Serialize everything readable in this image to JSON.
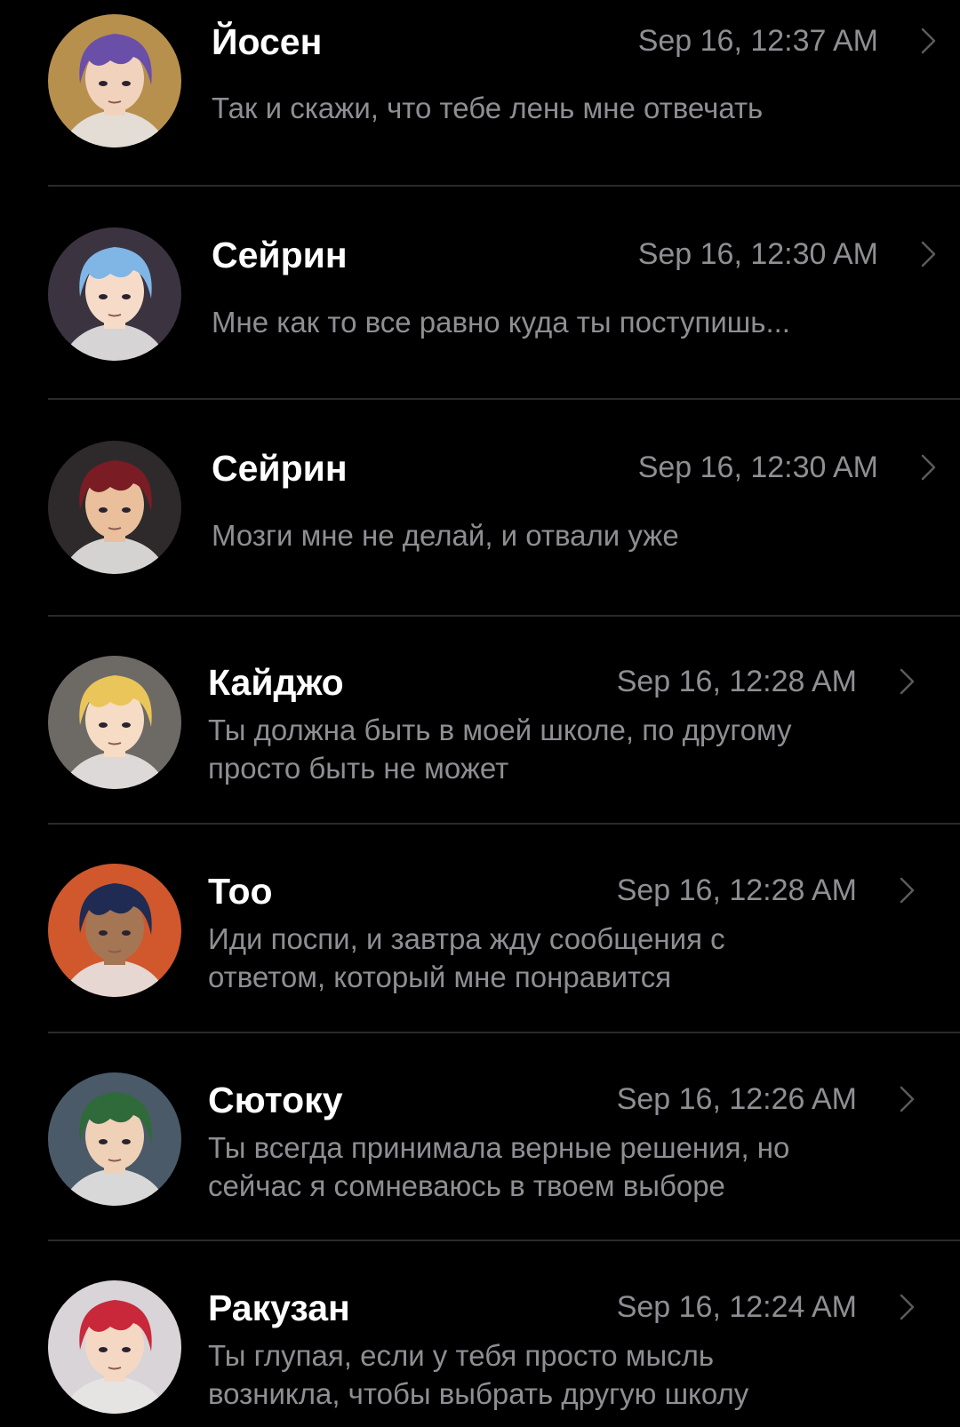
{
  "conversations": [
    {
      "name": "Йосен",
      "time": "Sep 16, 12:37 AM",
      "message_lines": [
        "Так и скажи, что тебе лень мне отвечать"
      ],
      "avatar": {
        "hair": "#6a4fa8",
        "skin": "#f1d3bd",
        "bg": "#b8904e",
        "icon": "avatar-purple-hair"
      }
    },
    {
      "name": "Сейрин",
      "time": "Sep 16, 12:30 AM",
      "message_lines": [
        "Мне как то все равно куда ты поступишь..."
      ],
      "avatar": {
        "hair": "#7fb6e6",
        "skin": "#f6dcc8",
        "bg": "#3b3440",
        "icon": "avatar-blue-hair"
      }
    },
    {
      "name": "Сейрин",
      "time": "Sep 16, 12:30 AM",
      "message_lines": [
        "Мозги мне не делай, и отвали уже"
      ],
      "avatar": {
        "hair": "#7a1c24",
        "skin": "#e9bf9c",
        "bg": "#2e2a2c",
        "icon": "avatar-red-hair"
      }
    },
    {
      "name": "Кайджо",
      "time": "Sep 16, 12:28 AM",
      "message_lines": [
        "Ты должна быть в моей школе, по другому",
        "просто быть не может"
      ],
      "avatar": {
        "hair": "#e9c55a",
        "skin": "#f6dcc4",
        "bg": "#6d6a66",
        "icon": "avatar-blonde-hair"
      }
    },
    {
      "name": "Тоо",
      "time": "Sep 16, 12:28 AM",
      "message_lines": [
        "Иди поспи, и завтра жду сообщения с",
        "ответом, который мне понравится"
      ],
      "avatar": {
        "hair": "#1f2b52",
        "skin": "#a57654",
        "bg": "#d0582c",
        "icon": "avatar-navy-hair"
      }
    },
    {
      "name": "Сютоку",
      "time": "Sep 16, 12:26 AM",
      "message_lines": [
        "Ты всегда принимала верные решения, но",
        "сейчас я сомневаюсь в твоем выборе"
      ],
      "avatar": {
        "hair": "#2f6a3a",
        "skin": "#efd1b8",
        "bg": "#4a5a68",
        "icon": "avatar-green-hair"
      }
    },
    {
      "name": "Ракузан",
      "time": "Sep 16, 12:24 AM",
      "message_lines": [
        "Ты глупая, если у тебя просто мысль",
        "возникла, чтобы выбрать другую школу"
      ],
      "avatar": {
        "hair": "#c8283a",
        "skin": "#f5d8c4",
        "bg": "#d8d4d8",
        "icon": "avatar-crimson-hair"
      }
    }
  ]
}
